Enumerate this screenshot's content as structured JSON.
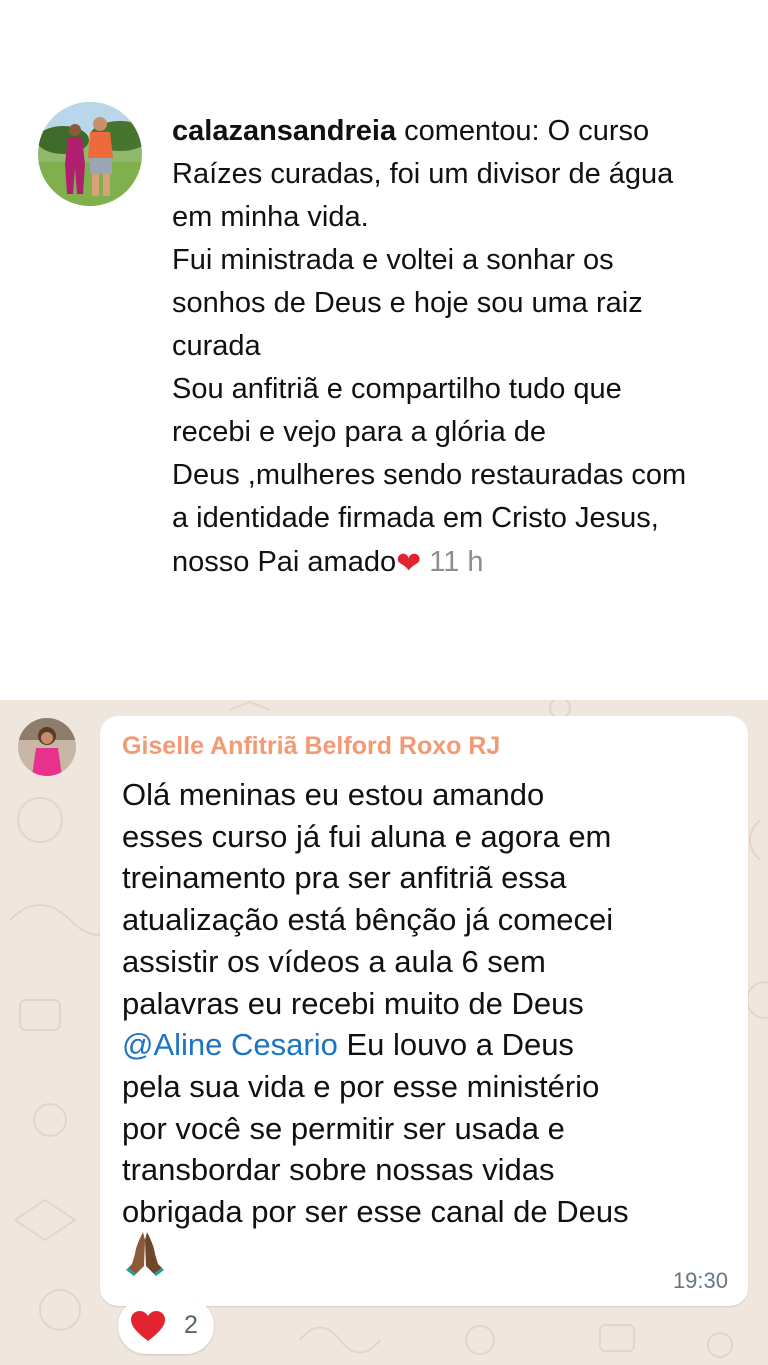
{
  "instagram_comment": {
    "username": "calazansandreia",
    "action": "comentou:",
    "first_line_rest": "O curso",
    "lines": [
      "Raízes curadas, foi um divisor de água",
      "em minha vida.",
      "Fui ministrada e voltei a sonhar os",
      "sonhos de Deus e hoje sou uma raiz",
      "curada",
      "Sou anfitriã e compartilho tudo que",
      "recebi e vejo para a glória de",
      "Deus ,mulheres sendo restauradas com",
      "a identidade firmada em Cristo Jesus,"
    ],
    "last_line": "nosso Pai amado",
    "heart_emoji": "❤",
    "time": "11 h"
  },
  "whatsapp_message": {
    "sender": "Giselle Anfitriã Belford Roxo RJ",
    "lines_before_mention": [
      "Olá meninas eu estou amando",
      "esses curso já fui aluna e agora em",
      "treinamento pra ser anfitriã essa",
      "atualização está bênção já comecei",
      "assistir os vídeos a aula 6 sem",
      "palavras eu recebi muito de Deus"
    ],
    "mention": "@Aline Cesario",
    "mention_line_rest": " Eu louvo a Deus",
    "lines_after_mention": [
      "pela sua vida e por esse ministério",
      "por você se permitir ser usada e",
      "transbordar sobre nossas vidas",
      "obrigada por ser esse canal de Deus"
    ],
    "emoji_icon": "praying-hands-icon",
    "time": "19:30",
    "reaction": {
      "icon": "heart-icon",
      "count": "2"
    }
  },
  "colors": {
    "sender_name": "#f29a74",
    "mention": "#1d74c2",
    "heart": "#e3232f",
    "timestamp_ig": "#8e8e8e",
    "timestamp_wa": "#667781",
    "wa_background": "#efe7dd"
  }
}
